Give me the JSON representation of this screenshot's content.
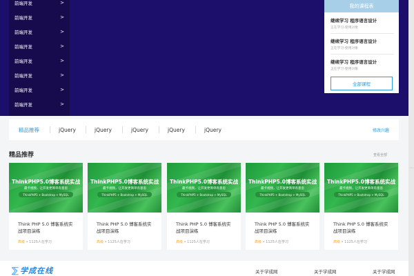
{
  "side_nav": {
    "items": [
      "前端开发",
      "前端开发",
      "前端开发",
      "前端开发",
      "前端开发",
      "前端开发",
      "前端开发",
      "前端开发"
    ],
    "chevron": ">"
  },
  "my_courses": {
    "title": "我的课程表",
    "courses": [
      {
        "title": "继续学习 程序语言设计",
        "sub": "正在学习-使用对象"
      },
      {
        "title": "继续学习 程序语言设计",
        "sub": "正在学习-使用对象"
      },
      {
        "title": "继续学习 程序语言设计",
        "sub": "正在学习-使用对象"
      }
    ],
    "all_button": "全部课程"
  },
  "tabs": {
    "items": [
      "精品推荐",
      "jQuery",
      "jQuery",
      "jQuery",
      "jQuery",
      "jQuery"
    ],
    "edit_label": "修改兴趣"
  },
  "section": {
    "title": "精品推荐",
    "more": "查看全部"
  },
  "cards": [
    {
      "img_title": "ThinkPHP5.0博客系统实战",
      "img_sub": "最卡视频，让开发更简单有意思",
      "img_tag": "ThinkPHP5 + Bootstrap + MySQL",
      "name": "Think PHP 5.0 博客系统实战项目演练",
      "level": "高级",
      "meta": "• 1125人在学习"
    },
    {
      "img_title": "ThinkPHP5.0博客系统实战",
      "img_sub": "最卡视频，让开发更简单有意思",
      "img_tag": "ThinkPHP5 + Bootstrap + MySQL",
      "name": "Think PHP 5.0 博客系统实战项目演练",
      "level": "高级",
      "meta": "• 1125人在学习"
    },
    {
      "img_title": "ThinkPHP5.0博客系统实战",
      "img_sub": "最卡视频，让开发更简单有意思",
      "img_tag": "ThinkPHP5 + Bootstrap + MySQL",
      "name": "Think PHP 5.0 博客系统实战项目演练",
      "level": "高级",
      "meta": "• 1125人在学习"
    },
    {
      "img_title": "ThinkPHP5.0博客系统实战",
      "img_sub": "最卡视频，让开发更简单有意思",
      "img_tag": "ThinkPHP5 + Bootstrap + MySQL",
      "name": "Think PHP 5.0 博客系统实战项目演练",
      "level": "高级",
      "meta": "• 1125人在学习"
    },
    {
      "img_title": "ThinkPHP5.0博客系统实战",
      "img_sub": "最卡视频，让开发更简单有意思",
      "img_tag": "ThinkPHP5 + Bootstrap + MySQL",
      "name": "Think PHP 5.0 博客系统实战项目演练",
      "level": "高级",
      "meta": "• 1125人在学习"
    }
  ],
  "footer": {
    "logo_text": "学成在线",
    "links": [
      "关于学成网",
      "关于学成网",
      "关于学成网"
    ]
  },
  "colors": {
    "hero_bg": "#1c0f6b",
    "accent": "#2a9bde",
    "card_green": "#34b74e",
    "level_orange": "#f5a623"
  },
  "icons": {
    "chevron": "chevron-right-icon",
    "logo": "xuecheng-logo-icon"
  }
}
